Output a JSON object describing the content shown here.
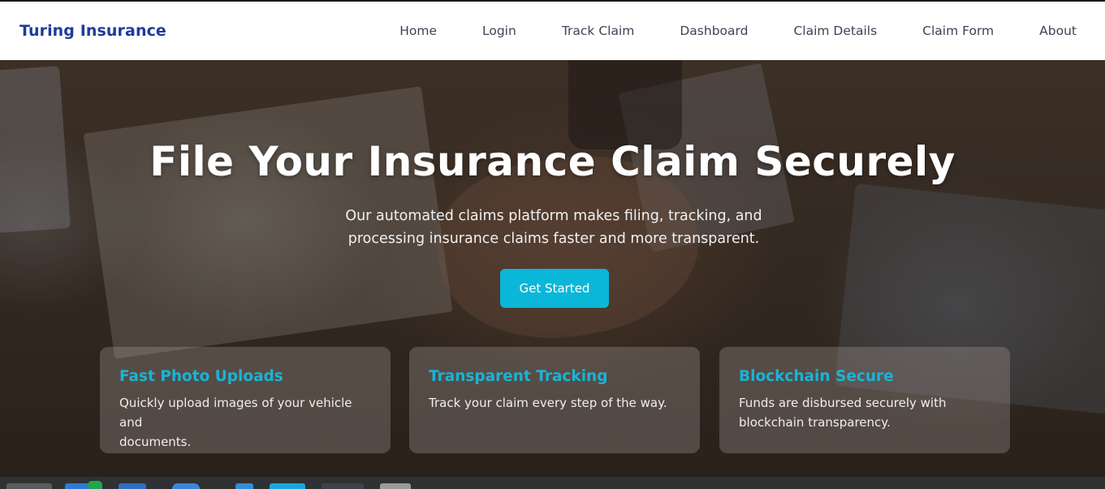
{
  "navbar": {
    "brand": "Turing Insurance",
    "links": [
      "Home",
      "Login",
      "Track Claim",
      "Dashboard",
      "Claim Details",
      "Claim Form",
      "About"
    ]
  },
  "hero": {
    "title": "File Your Insurance Claim Securely",
    "subtitle_line1": "Our automated claims platform makes filing, tracking, and",
    "subtitle_line2": "processing insurance claims faster and more transparent.",
    "cta_label": "Get Started"
  },
  "features": [
    {
      "title": "Fast Photo Uploads",
      "text_line1": "Quickly upload images of your vehicle and",
      "text_line2": "documents."
    },
    {
      "title": "Transparent Tracking",
      "text_line1": "Track your claim every step of the way.",
      "text_line2": ""
    },
    {
      "title": "Blockchain Secure",
      "text_line1": "Funds are disbursed securely with",
      "text_line2": "blockchain transparency."
    }
  ],
  "colors": {
    "brand": "#1e3a9a",
    "accent": "#0bb7d8",
    "card_title": "#19b4d6"
  },
  "taskbar": {
    "icons": [
      "folder-icon",
      "app-icon",
      "app-icon",
      "browser-icon",
      "app-icon",
      "folder-icon",
      "app-icon",
      "app-icon"
    ]
  }
}
